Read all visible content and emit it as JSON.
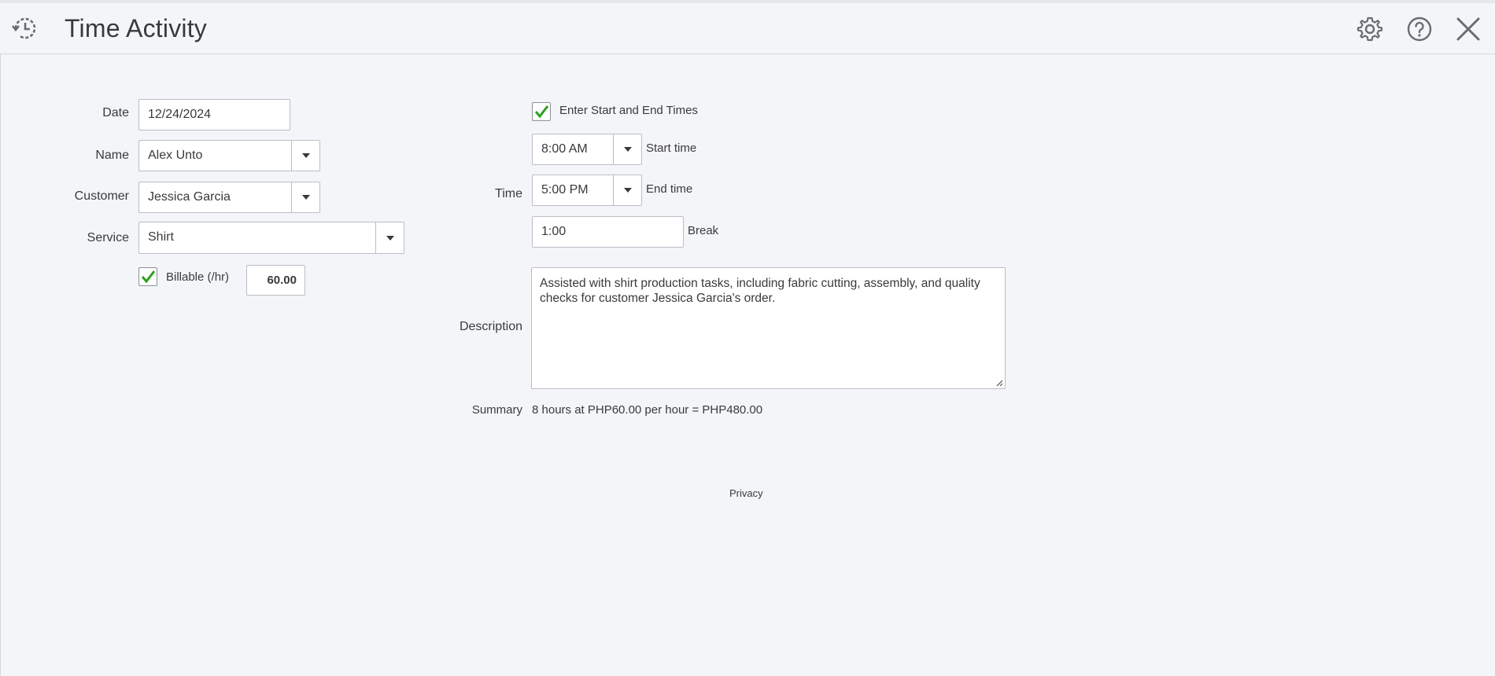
{
  "header": {
    "title": "Time Activity",
    "icons": [
      "recent-transactions-icon",
      "gear-icon",
      "help-icon",
      "close-icon"
    ]
  },
  "form": {
    "date": {
      "label": "Date",
      "value": "12/24/2024"
    },
    "name": {
      "label": "Name",
      "value": "Alex Unto"
    },
    "customer": {
      "label": "Customer",
      "value": "Jessica Garcia"
    },
    "service": {
      "label": "Service",
      "value": "Shirt"
    },
    "billable": {
      "label": "Billable (/hr)",
      "checked": true,
      "rate": "60.00"
    },
    "enter_times": {
      "label": "Enter Start and End Times",
      "checked": true
    },
    "time_label": "Time",
    "start_time": {
      "label": "Start time",
      "value": "8:00 AM"
    },
    "end_time": {
      "label": "End time",
      "value": "5:00 PM"
    },
    "break": {
      "label": "Break",
      "value": "1:00"
    },
    "description": {
      "label": "Description",
      "value": "Assisted with shirt production tasks, including fabric cutting, assembly, and quality checks for customer Jessica Garcia's order."
    },
    "summary": {
      "label": "Summary",
      "value": "8 hours at PHP60.00 per hour = PHP480.00"
    }
  },
  "footer": {
    "privacy": "Privacy"
  },
  "colors": {
    "check": "#2ca01c",
    "background": "#f4f5f8",
    "text": "#393a3d",
    "border": "#babec5"
  }
}
